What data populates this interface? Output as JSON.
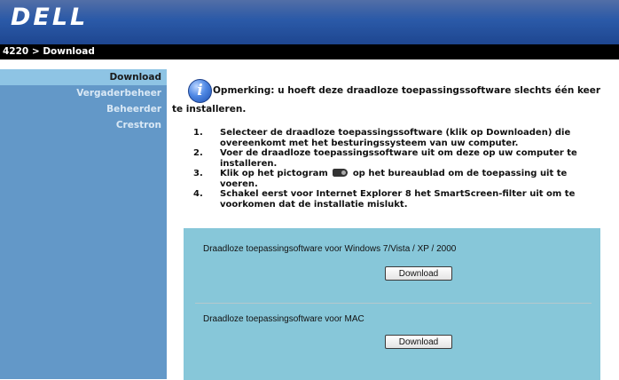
{
  "header": {
    "logo_text": "DELL"
  },
  "breadcrumb": "4220 > Download",
  "sidebar": {
    "items": [
      {
        "label": "Download",
        "active": true
      },
      {
        "label": "Vergaderbeheer",
        "active": false
      },
      {
        "label": "Beheerder",
        "active": false
      },
      {
        "label": "Crestron",
        "active": false
      }
    ]
  },
  "note": {
    "icon": "info-icon",
    "line1": "Opmerking: u hoeft deze draadloze toepassingssoftware slechts één keer",
    "line2": "te installeren."
  },
  "steps": [
    {
      "num": "1.",
      "text": "Selecteer de draadloze toepassingssoftware (klik op Downloaden) die overeenkomt met het besturingssysteem van uw computer."
    },
    {
      "num": "2.",
      "text": "Voer de draadloze toepassingssoftware uit om deze op uw computer te installeren."
    },
    {
      "num": "3.",
      "text_before": "Klik op het pictogram",
      "text_after": "op het bureaublad om de toepassing uit te voeren.",
      "icon": "projector-icon"
    },
    {
      "num": "4.",
      "text": "Schakel eerst voor Internet Explorer 8 het SmartScreen-filter uit om te voorkomen dat de installatie mislukt."
    }
  ],
  "downloads": [
    {
      "label": "Draadloze toepassingsoftware voor Windows 7/Vista / XP / 2000",
      "button": "Download"
    },
    {
      "label": "Draadloze toepassingsoftware voor MAC",
      "button": "Download"
    }
  ],
  "colors": {
    "header": "#2b5aa8",
    "sidebar": "#6398c8",
    "sidebar_active": "#8ec4e4",
    "panel": "#87c7d9"
  }
}
